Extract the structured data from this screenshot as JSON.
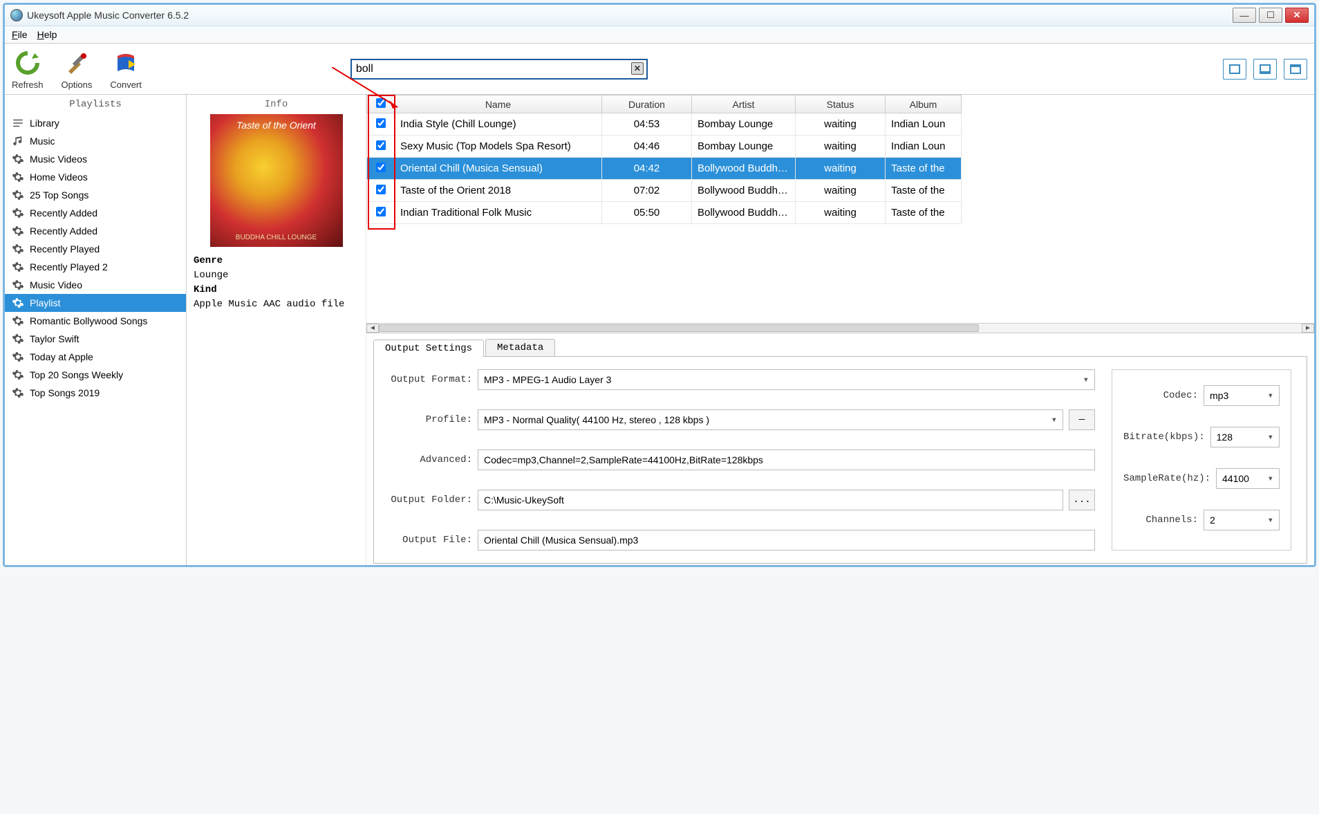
{
  "window": {
    "title": "Ukeysoft Apple Music Converter 6.5.2"
  },
  "menu": {
    "file": "File",
    "help": "Help"
  },
  "toolbar": {
    "refresh_label": "Refresh",
    "options_label": "Options",
    "convert_label": "Convert"
  },
  "search": {
    "value": "boll"
  },
  "sidebar": {
    "header": "Playlists",
    "items": [
      {
        "label": "Library",
        "icon": "library-icon"
      },
      {
        "label": "Music",
        "icon": "music-icon"
      },
      {
        "label": "Music Videos",
        "icon": "gear-icon"
      },
      {
        "label": "Home Videos",
        "icon": "gear-icon"
      },
      {
        "label": "25 Top Songs",
        "icon": "gear-icon"
      },
      {
        "label": "Recently Added",
        "icon": "gear-icon"
      },
      {
        "label": "Recently Added",
        "icon": "gear-icon"
      },
      {
        "label": "Recently Played",
        "icon": "gear-icon"
      },
      {
        "label": "Recently Played 2",
        "icon": "gear-icon"
      },
      {
        "label": "Music Video",
        "icon": "gear-icon"
      },
      {
        "label": "Playlist",
        "icon": "gear-icon",
        "selected": true
      },
      {
        "label": "Romantic Bollywood Songs",
        "icon": "gear-icon"
      },
      {
        "label": "Taylor Swift",
        "icon": "gear-icon"
      },
      {
        "label": "Today at Apple",
        "icon": "gear-icon"
      },
      {
        "label": "Top 20 Songs Weekly",
        "icon": "gear-icon"
      },
      {
        "label": "Top Songs 2019",
        "icon": "gear-icon"
      }
    ]
  },
  "info": {
    "header": "Info",
    "album_title": "Taste of the Orient",
    "album_footer": "BUDDHA CHILL LOUNGE",
    "genre_label": "Genre",
    "genre_value": "Lounge",
    "kind_label": "Kind",
    "kind_value": "Apple Music AAC audio file"
  },
  "table": {
    "columns": {
      "check": "",
      "name": "Name",
      "duration": "Duration",
      "artist": "Artist",
      "status": "Status",
      "album": "Album"
    },
    "rows": [
      {
        "name": "India Style (Chill Lounge)",
        "duration": "04:53",
        "artist": "Bombay Lounge",
        "status": "waiting",
        "album": "Indian Loun",
        "checked": true
      },
      {
        "name": "Sexy Music (Top Models Spa Resort)",
        "duration": "04:46",
        "artist": "Bombay Lounge",
        "status": "waiting",
        "album": "Indian Loun",
        "checked": true
      },
      {
        "name": "Oriental Chill (Musica Sensual)",
        "duration": "04:42",
        "artist": "Bollywood Buddha...",
        "status": "waiting",
        "album": "Taste of the",
        "checked": true,
        "selected": true
      },
      {
        "name": "Taste of the Orient 2018",
        "duration": "07:02",
        "artist": "Bollywood Buddha...",
        "status": "waiting",
        "album": "Taste of the",
        "checked": true
      },
      {
        "name": "Indian Traditional Folk Music",
        "duration": "05:50",
        "artist": "Bollywood Buddha...",
        "status": "waiting",
        "album": "Taste of the",
        "checked": true
      }
    ]
  },
  "tabs": {
    "output_settings": "Output Settings",
    "metadata": "Metadata"
  },
  "settings": {
    "output_format_label": "Output Format:",
    "output_format_value": "MP3 - MPEG-1 Audio Layer 3",
    "profile_label": "Profile:",
    "profile_value": "MP3 - Normal Quality( 44100 Hz, stereo , 128 kbps )",
    "profile_aux": "—",
    "advanced_label": "Advanced:",
    "advanced_value": "Codec=mp3,Channel=2,SampleRate=44100Hz,BitRate=128kbps",
    "output_folder_label": "Output Folder:",
    "output_folder_value": "C:\\Music-UkeySoft",
    "browse_btn": "...",
    "output_file_label": "Output File:",
    "output_file_value": "Oriental Chill (Musica Sensual).mp3",
    "codec_label": "Codec:",
    "codec_value": "mp3",
    "bitrate_label": "Bitrate(kbps):",
    "bitrate_value": "128",
    "samplerate_label": "SampleRate(hz):",
    "samplerate_value": "44100",
    "channels_label": "Channels:",
    "channels_value": "2"
  }
}
